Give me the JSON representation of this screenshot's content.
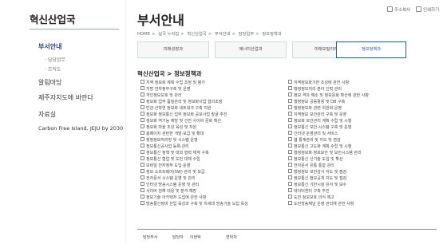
{
  "sidebar": {
    "title": "혁신산업국",
    "items": [
      {
        "label": "부서안내",
        "active": true
      },
      {
        "label": "알림마당"
      },
      {
        "label": "제주자치도에 바란다"
      },
      {
        "label": "자료실"
      }
    ],
    "subitems": [
      "담당업무",
      "조직도"
    ],
    "carbon": "Carbon Free Island, JEJU by 2030"
  },
  "header": {
    "title": "부서안내",
    "breadcrumb": [
      "HOME",
      "실국 누리집",
      "혁신산업국",
      "부서안내",
      "담당업무",
      "정보정책과"
    ],
    "utils": {
      "print": "인쇄하기",
      "copy_url": "주소복사"
    }
  },
  "tabs": [
    "미래성장과",
    "에너지산업과",
    "미래모빌리티과",
    "정보정책과"
  ],
  "active_tab": 3,
  "section_title": "혁신산업국 > 정보정책과",
  "duties_left": [
    "지역 정보화 계획 수립 조정 및 평가",
    "지방 전자정부구축 및 운영",
    "개인정보보호 및 관리",
    "정보화 업무 품질관리 및 정보화사업 협의조정",
    "민관·산학연 정보화 네트워크 구축 지원",
    "정보화 정보통신 업무 정보화 공모사업 발굴·추진",
    "정보화 역기능 예방 및 건전 사이버 문화 확산",
    "정보화 마을 조성 육성 및 지원",
    "홈페이지 관련한 개발·보급 및 확대",
    "행정정보처리망 및 시스템 운영",
    "정보통신공사업 등록·관리",
    "정보통신 정책 및 대외 협력 체계 구축",
    "정보통신 협업 및 도민 대체 수립",
    "모바일 전자정부 도입·운영",
    "정보 소프트웨어(SW) 관리 및 보급",
    "전자문서 시스템 운영 및 관리",
    "인터넷 방송시스템 운영 및 관리",
    "사이버 침해 대응 및 분석·예방",
    "정보기술 아키텍처 도입에 관한 사항",
    "방송통신정비 산업 육성과 구축 및 차세대 방송기술 도입 육성"
  ],
  "duties_right": [
    "지역정보화기반 조성에 관한 사항",
    "행정정보처리 분야 인력 관리",
    "정보 격차 해소 및 정보문화 확산에 관한 사항",
    "행정정보 공동활용 및 DB 구축",
    "행정정보화 관련 위원회 운영",
    "지역정보 보안관리 구축 및 운영",
    "정보화 보안관리 계획 수립 및 시행",
    "정보통신 보안·시스템 구축 및 운영",
    "인터넷 운영관리 및 서비스",
    "웹 통계관리 및 지도 및 점검",
    "정보통신 고도화 계획 수립 및 시행",
    "행정정보화·정보보안 및 보안시스템 관리",
    "정보통신 신기술 도입 및 확산",
    "전자문서 유통 통합 관리",
    "행정정보 보안감사 지도 및 점검",
    "정보통신 정보공개 지도 및 점검",
    "정보통신 기반시설 유지 및 보수",
    "데이터센터 구축 추진",
    "도민 정보보호 의식 제고",
    "도민방송채널 운영 관리에 관한 사항"
  ],
  "table_headers": [
    "담당부서",
    "담당자",
    "이현탁",
    "연락처"
  ]
}
